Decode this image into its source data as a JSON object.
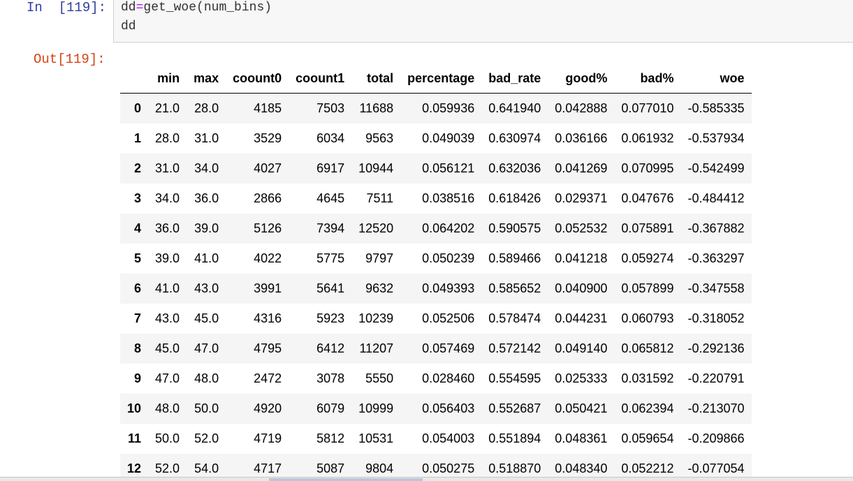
{
  "input_cell": {
    "prompt": "In  [119]:",
    "code_lines": [
      {
        "pre": "dd",
        "op": "=",
        "post": "get_woe(num_bins)"
      },
      {
        "pre": "dd",
        "op": "",
        "post": ""
      }
    ]
  },
  "output_cell": {
    "prompt": "Out[119]:"
  },
  "table": {
    "columns": [
      "",
      "min",
      "max",
      "coount0",
      "coount1",
      "total",
      "percentage",
      "bad_rate",
      "good%",
      "bad%",
      "woe"
    ],
    "rows": [
      [
        "0",
        "21.0",
        "28.0",
        "4185",
        "7503",
        "11688",
        "0.059936",
        "0.641940",
        "0.042888",
        "0.077010",
        "-0.585335"
      ],
      [
        "1",
        "28.0",
        "31.0",
        "3529",
        "6034",
        "9563",
        "0.049039",
        "0.630974",
        "0.036166",
        "0.061932",
        "-0.537934"
      ],
      [
        "2",
        "31.0",
        "34.0",
        "4027",
        "6917",
        "10944",
        "0.056121",
        "0.632036",
        "0.041269",
        "0.070995",
        "-0.542499"
      ],
      [
        "3",
        "34.0",
        "36.0",
        "2866",
        "4645",
        "7511",
        "0.038516",
        "0.618426",
        "0.029371",
        "0.047676",
        "-0.484412"
      ],
      [
        "4",
        "36.0",
        "39.0",
        "5126",
        "7394",
        "12520",
        "0.064202",
        "0.590575",
        "0.052532",
        "0.075891",
        "-0.367882"
      ],
      [
        "5",
        "39.0",
        "41.0",
        "4022",
        "5775",
        "9797",
        "0.050239",
        "0.589466",
        "0.041218",
        "0.059274",
        "-0.363297"
      ],
      [
        "6",
        "41.0",
        "43.0",
        "3991",
        "5641",
        "9632",
        "0.049393",
        "0.585652",
        "0.040900",
        "0.057899",
        "-0.347558"
      ],
      [
        "7",
        "43.0",
        "45.0",
        "4316",
        "5923",
        "10239",
        "0.052506",
        "0.578474",
        "0.044231",
        "0.060793",
        "-0.318052"
      ],
      [
        "8",
        "45.0",
        "47.0",
        "4795",
        "6412",
        "11207",
        "0.057469",
        "0.572142",
        "0.049140",
        "0.065812",
        "-0.292136"
      ],
      [
        "9",
        "47.0",
        "48.0",
        "2472",
        "3078",
        "5550",
        "0.028460",
        "0.554595",
        "0.025333",
        "0.031592",
        "-0.220791"
      ],
      [
        "10",
        "48.0",
        "50.0",
        "4920",
        "6079",
        "10999",
        "0.056403",
        "0.552687",
        "0.050421",
        "0.062394",
        "-0.213070"
      ],
      [
        "11",
        "50.0",
        "52.0",
        "4719",
        "5812",
        "10531",
        "0.054003",
        "0.551894",
        "0.048361",
        "0.059654",
        "-0.209866"
      ],
      [
        "12",
        "52.0",
        "54.0",
        "4717",
        "5087",
        "9804",
        "0.050275",
        "0.518870",
        "0.048340",
        "0.052212",
        "-0.077054"
      ]
    ]
  }
}
